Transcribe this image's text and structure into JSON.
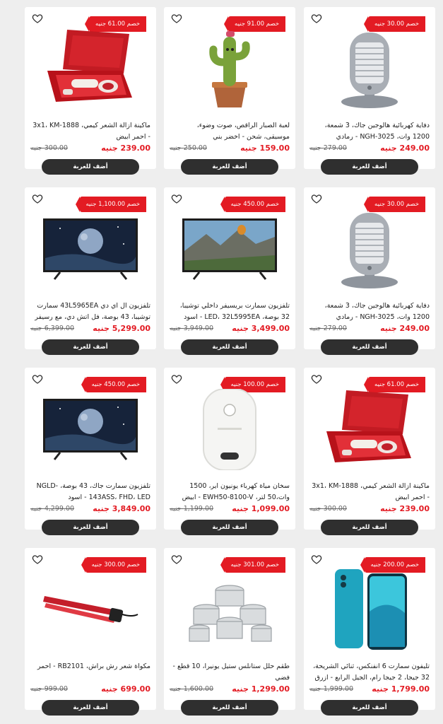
{
  "products": [
    {
      "discount": "خصم 30.00 جنيه",
      "name": "دفاية كهربائية هالوجين جاك، 3 شمعة، 1200 وات، NGH-3025 - رمادي",
      "price": "249.00 جنيه",
      "old_price": "279.00 جنيه",
      "button": "أضف للعربة",
      "image": "heater"
    },
    {
      "discount": "خصم 91.00 جنيه",
      "name": "لعبة الصبار الراقص، صوت وضوء، موسيقى، شحن - اخضر بني",
      "price": "159.00 جنيه",
      "old_price": "250.00 جنيه",
      "button": "أضف للعربة",
      "image": "cactus-toy"
    },
    {
      "discount": "خصم 61.00 جنيه",
      "name": "ماكينة ازالة الشعر كيمي، 3x1، KM-1888 - احمر ابيض",
      "price": "239.00 جنيه",
      "old_price": "300.00 جنيه",
      "button": "أضف للعربة",
      "image": "epilator-case"
    },
    {
      "discount": "خصم 30.00 جنيه",
      "name": "دفاية كهربائية هالوجين جاك، 3 شمعة، 1200 وات، NGH-3025 - رمادي",
      "price": "249.00 جنيه",
      "old_price": "279.00 جنيه",
      "button": "أضف للعربة",
      "image": "heater"
    },
    {
      "discount": "خصم 450.00 جنيه",
      "name": "تلفزيون سمارت بريسيفر داخلي توشيبا، 32 بوصة، LED، 32L5995EA - اسود",
      "price": "3,499.00 جنيه",
      "old_price": "3,949.00 جنيه",
      "button": "أضف للعربة",
      "image": "tv-landscape"
    },
    {
      "discount": "خصم 1,100.00 جنيه",
      "name": "تلفزيون ال اي دي 43L5965EA سمارت توشيبا، 43 بوصة، فل اتش دي، مع رسيفر داخلي - اسود",
      "price": "5,299.00 جنيه",
      "old_price": "6,399.00 جنيه",
      "button": "أضف للعربة",
      "image": "tv-space"
    },
    {
      "discount": "خصم 61.00 جنيه",
      "name": "ماكينة ازالة الشعر كيمي، 3x1، KM-1888 - احمر ابيض",
      "price": "239.00 جنيه",
      "old_price": "300.00 جنيه",
      "button": "أضف للعربة",
      "image": "epilator-case"
    },
    {
      "discount": "خصم 100.00 جنيه",
      "name": "سخان مياة كهرباء يونيون اير، 1500 وات،50 لتر، EWH50-8100-V - ابيض",
      "price": "1,099.00 جنيه",
      "old_price": "1,199.00 جنيه",
      "button": "أضف للعربة",
      "image": "water-heater"
    },
    {
      "discount": "خصم 450.00 جنيه",
      "name": "تلفزيون سمارت جاك، 43 بوصة، NGLD-143ASS، FHD، LED - اسود",
      "price": "3,849.00 جنيه",
      "old_price": "4,299.00 جنيه",
      "button": "أضف للعربة",
      "image": "tv-space"
    },
    {
      "discount": "خصم 200.00 جنيه",
      "name": "تليفون سمارت 6 انفنكس، ثنائي الشريحة، 32 جيجا، 2 جيجا رام، الجيل الرابع - ازرق فاتح",
      "price": "1,799.00 جنيه",
      "old_price": "1,999.00 جنيه",
      "button": "أضف للعربة",
      "image": "phone"
    },
    {
      "discount": "خصم 301.00 جنيه",
      "name": "طقم حلل ستانلس ستيل يونيرا، 10 قطع - فضي",
      "price": "1,299.00 جنيه",
      "old_price": "1,600.00 جنيه",
      "button": "أضف للعربة",
      "image": "cookware"
    },
    {
      "discount": "خصم 300.00 جنيه",
      "name": "مكواة شعر رش براش، RB2101 - احمر",
      "price": "699.00 جنيه",
      "old_price": "999.00 جنيه",
      "button": "أضف للعربة",
      "image": "hair-iron"
    }
  ]
}
